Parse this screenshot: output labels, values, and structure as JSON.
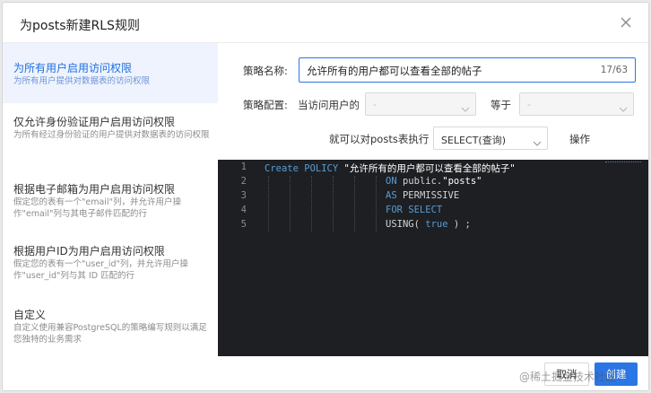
{
  "dialog": {
    "title": "为posts新建RLS规则"
  },
  "sidebar": {
    "items": [
      {
        "title": "为所有用户启用访问权限",
        "desc": "为所有用户提供对数据表的访问权限"
      },
      {
        "title": "仅允许身份验证用户启用访问权限",
        "desc": "为所有经过身份验证的用户提供对数据表的访问权限"
      },
      {
        "title": "根据电子邮箱为用户启用访问权限",
        "desc": "假定您的表有一个\"email\"列，并允许用户操作\"email\"列与其电子邮件匹配的行"
      },
      {
        "title": "根据用户ID为用户启用访问权限",
        "desc": "假定您的表有一个\"user_id\"列，并允许用户操作\"user_id\"列与其 ID 匹配的行"
      },
      {
        "title": "自定义",
        "desc": "自定义使用兼容PostgreSQL的策略编写规则以满足您独特的业务需求"
      }
    ]
  },
  "form": {
    "policy_name_label": "策略名称:",
    "policy_name_value": "允许所有的用户都可以查看全部的帖子",
    "policy_name_count": "17/63",
    "policy_config_label": "策略配置:",
    "when_user_label": "当访问用户的",
    "select1_value": "-",
    "equals_label": "等于",
    "select2_value": "-",
    "exec_label": "就可以对posts表执行",
    "operation_value": "SELECT(查询)",
    "operation_label": "操作"
  },
  "editor": {
    "lines": [
      {
        "num": "1",
        "text": "Create POLICY \"允许所有的用户都可以查看全部的帖子\""
      },
      {
        "num": "2",
        "text": "ON public.\"posts\""
      },
      {
        "num": "3",
        "text": "AS PERMISSIVE"
      },
      {
        "num": "4",
        "text": "FOR SELECT"
      },
      {
        "num": "5",
        "text": "USING( true ) ;"
      }
    ],
    "l1_kw": "Create POLICY",
    "l1_str": "\"允许所有的用户都可以查看全部的帖子\"",
    "l2_kw": "ON",
    "l2_plain": "public.",
    "l2_str": "\"posts\"",
    "l3_kw": "AS",
    "l3_plain": "PERMISSIVE",
    "l4_kw": "FOR SELECT",
    "l5_kw": "USING(",
    "l5_val": "true",
    "l5_end": ") ;"
  },
  "footer": {
    "cancel_label": "取消",
    "create_label": "创建",
    "watermark": "@稀土掘金技术社区"
  },
  "colors": {
    "accent": "#2b76e5",
    "active_bg": "#eef3fd",
    "editor_bg": "#1e1f22",
    "keyword": "#569cd6"
  }
}
